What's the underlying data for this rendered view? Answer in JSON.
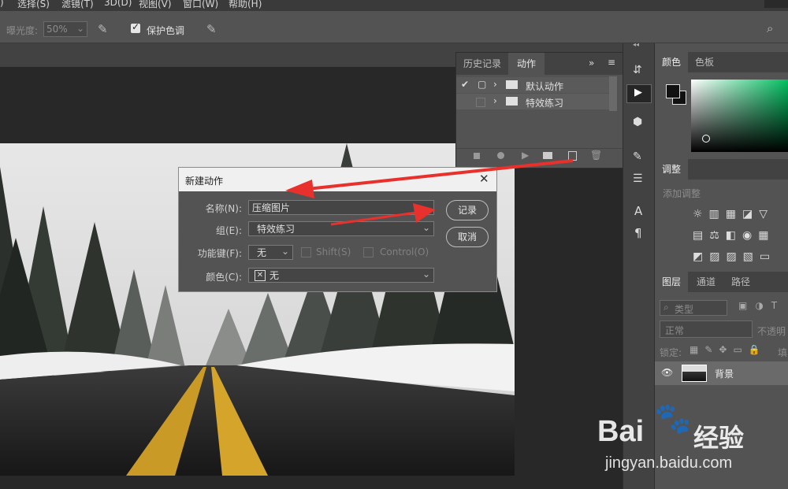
{
  "menu": [
    "选择(S)",
    "滤镜(T)",
    "3D(D)",
    "视图(V)",
    "窗口(W)",
    "帮助(H)"
  ],
  "options": {
    "exposure_label": "曝光度:",
    "exposure_value": "50%",
    "protect_tones": "保护色调"
  },
  "actions_panel": {
    "tabs": [
      "历史记录",
      "动作"
    ],
    "rows": [
      {
        "label": "默认动作"
      },
      {
        "label": "特效练习"
      }
    ]
  },
  "dialog": {
    "title": "新建动作",
    "name_label": "名称(N):",
    "name_value": "压缩图片",
    "group_label": "组(E):",
    "group_value": "特效练习",
    "fkey_label": "功能键(F):",
    "fkey_value": "无",
    "shift_label": "Shift(S)",
    "control_label": "Control(O)",
    "color_label": "颜色(C):",
    "color_value": "无",
    "record_button": "记录",
    "cancel_button": "取消"
  },
  "right_panel": {
    "color_tabs": [
      "颜色",
      "色板"
    ],
    "adjust_tab": "调整",
    "adjust_hint": "添加调整",
    "layer_tabs": [
      "图层",
      "通道",
      "路径"
    ],
    "kind_label": "类型",
    "blend_mode": "正常",
    "opacity_label": "不透明",
    "lock_label": "锁定:",
    "fill_label": "填",
    "layer_name": "背景"
  },
  "watermark": {
    "brand": "Bai",
    "brand2": "经验",
    "url": "jingyan.baidu.com"
  },
  "colors": {
    "accent_arrow": "#e8302c",
    "dialog_border": "#8a8a8a",
    "photo_road": "#222222",
    "yellow_line": "#d4a52a"
  }
}
